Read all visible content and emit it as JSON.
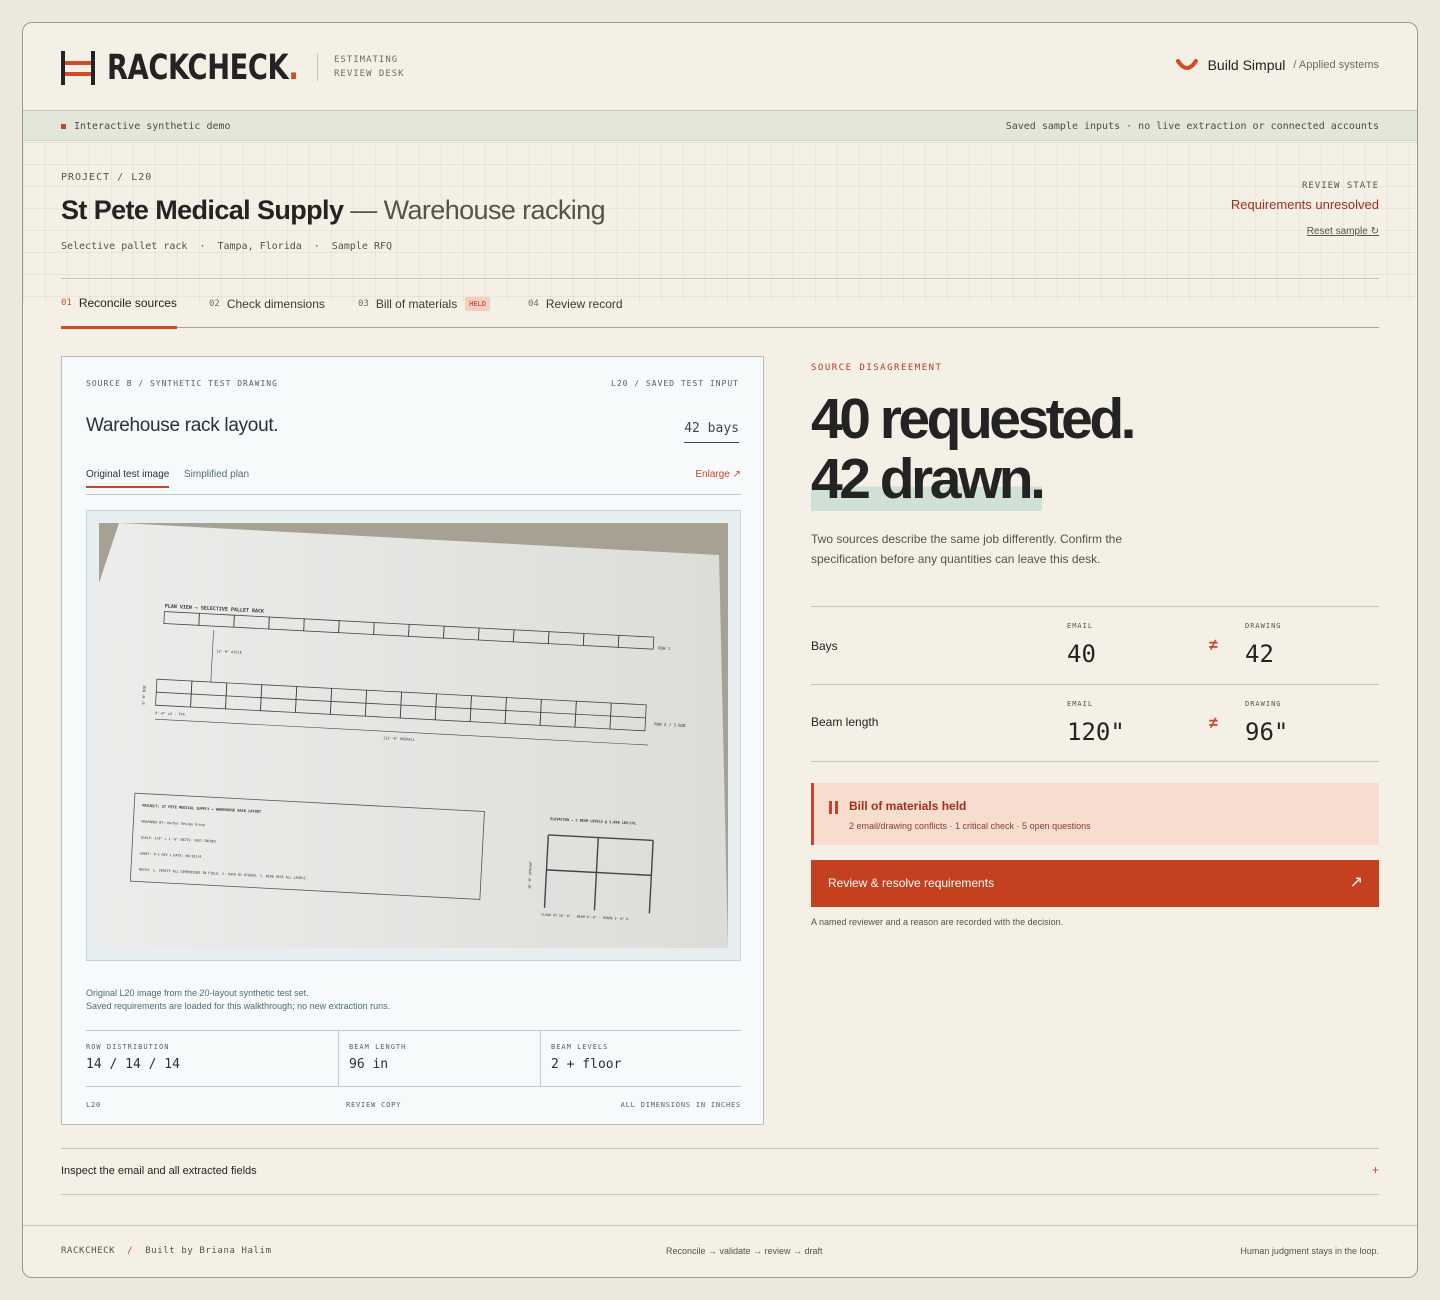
{
  "app": {
    "logo_text": "RACKCHECK",
    "logo_dot": ".",
    "subtitle_line1": "ESTIMATING",
    "subtitle_line2": "REVIEW DESK",
    "brand_name": "Build Simpul",
    "brand_sub": "/ Applied systems",
    "accent": "#d24a26"
  },
  "notice": {
    "left": "Interactive synthetic demo",
    "right": "Saved sample inputs · no live extraction or connected accounts"
  },
  "project": {
    "breadcrumb": "PROJECT / L20",
    "name": "St Pete Medical Supply",
    "subtitle": "— Warehouse racking",
    "meta": [
      "Selective pallet rack",
      "Tampa, Florida",
      "Sample RFQ"
    ],
    "meta_sep": "·"
  },
  "review_state": {
    "label": "REVIEW STATE",
    "value": "Requirements unresolved",
    "reset": "Reset sample ↻"
  },
  "tabs": [
    {
      "num": "01",
      "label": "Reconcile sources"
    },
    {
      "num": "02",
      "label": "Check dimensions"
    },
    {
      "num": "03",
      "label": "Bill of materials",
      "badge": "HELD"
    },
    {
      "num": "04",
      "label": "Review record"
    }
  ],
  "source_card": {
    "header_left": "SOURCE B / SYNTHETIC TEST DRAWING",
    "header_right": "L20 / SAVED TEST INPUT",
    "title": "Warehouse rack layout.",
    "count": "42 bays",
    "view_tabs": [
      "Original test image",
      "Simplified plan"
    ],
    "enlarge": "Enlarge ↗",
    "drawing": {
      "plan_title": "PLAN VIEW — SELECTIVE PALLET RACK",
      "aisle": "12'-0\" AISLE",
      "row1": "ROW 1",
      "row23": "ROW 2 / 3  B2B",
      "depth": "8'-0\" B2B",
      "overall_small": "9'-0\" x3 · TYP.",
      "overall": "112'-0\" OVERALL",
      "tb_project": "PROJECT: ST PETE MEDICAL SUPPLY — WAREHOUSE RACK LAYOUT",
      "tb_prepared": "PREPARED BY: Harbor Design Group",
      "tb_scale": "SCALE: 1/8\" = 1'-0\"     UNITS: FEET-INCHES",
      "tb_sheet": "SHEET: R-1   REV 1    DATE: 06/18/24",
      "tb_notes": "NOTES: 1. VERIFY ALL DIMENSIONS IN FIELD.  2. RACK BY OTHERS.  3. WIRE DECK ALL LEVELS.",
      "elev_title": "ELEVATION — 2 BEAM LEVELS @ 3,000 LBS/LVL",
      "elev_height": "16'-0\" UPRIGHT",
      "elev_caption": "CLEAR AT 10'-0\"   ·   BEAM 8'-0\"   ·   FRAME 3'-6\" D"
    },
    "caption_line1": "Original L20 image from the 20-layout synthetic test set.",
    "caption_line2": "Saved requirements are loaded for this walkthrough; no new extraction runs.",
    "specs": [
      {
        "label": "ROW DISTRIBUTION",
        "value": "14 / 14 / 14"
      },
      {
        "label": "BEAM LENGTH",
        "value": "96 in"
      },
      {
        "label": "BEAM LEVELS",
        "value": "2 + floor"
      }
    ],
    "footer": [
      "L20",
      "REVIEW COPY",
      "ALL DIMENSIONS IN INCHES"
    ]
  },
  "disagreement": {
    "label": "SOURCE DISAGREEMENT",
    "line1": "40 requested.",
    "line2": "42 drawn.",
    "description": "Two sources describe the same job differently. Confirm the specification before any quantities can leave this desk.",
    "rows": [
      {
        "name": "Bays",
        "email_label": "EMAIL",
        "email_value": "40",
        "neq": "≠",
        "drawing_label": "DRAWING",
        "drawing_value": "42"
      },
      {
        "name": "Beam length",
        "email_label": "EMAIL",
        "email_value": "120\"",
        "neq": "≠",
        "drawing_label": "DRAWING",
        "drawing_value": "96\""
      }
    ],
    "held_title": "Bill of materials held",
    "held_sub": "2 email/drawing conflicts · 1 critical check · 5 open questions",
    "cta_label": "Review & resolve requirements",
    "cta_arrow": "↗",
    "note": "A named reviewer and a reason are recorded with the decision."
  },
  "inspect": {
    "label": "Inspect the email and all extracted fields",
    "toggle": "+"
  },
  "footer": {
    "brand": "RACKCHECK",
    "slash": "/",
    "credit": "Built by Briana Halim",
    "flow": "Reconcile → validate → review → draft",
    "tagline": "Human judgment stays in the loop."
  }
}
